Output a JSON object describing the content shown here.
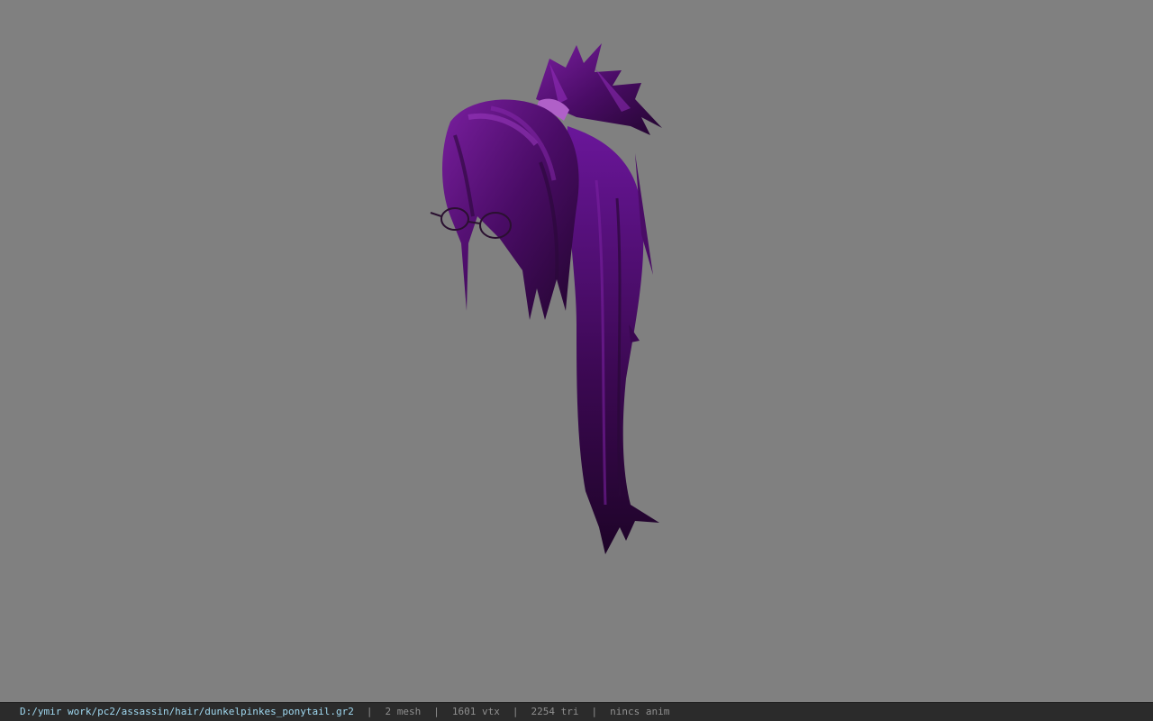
{
  "viewport": {
    "background_color": "#808080",
    "model_colors": {
      "hair_dark": "#2a0838",
      "hair_mid": "#5a0f78",
      "hair_light": "#8a2ab0",
      "hair_tie": "#b060c8",
      "glasses": "#2a1030"
    }
  },
  "statusbar": {
    "file_path": "D:/ymir work/pc2/assassin/hair/dunkelpinkes_ponytail.gr2",
    "separator": "|",
    "mesh_count": "2 mesh",
    "vertex_count": "1601 vtx",
    "triangle_count": "2254 tri",
    "animation": "nincs anim"
  }
}
